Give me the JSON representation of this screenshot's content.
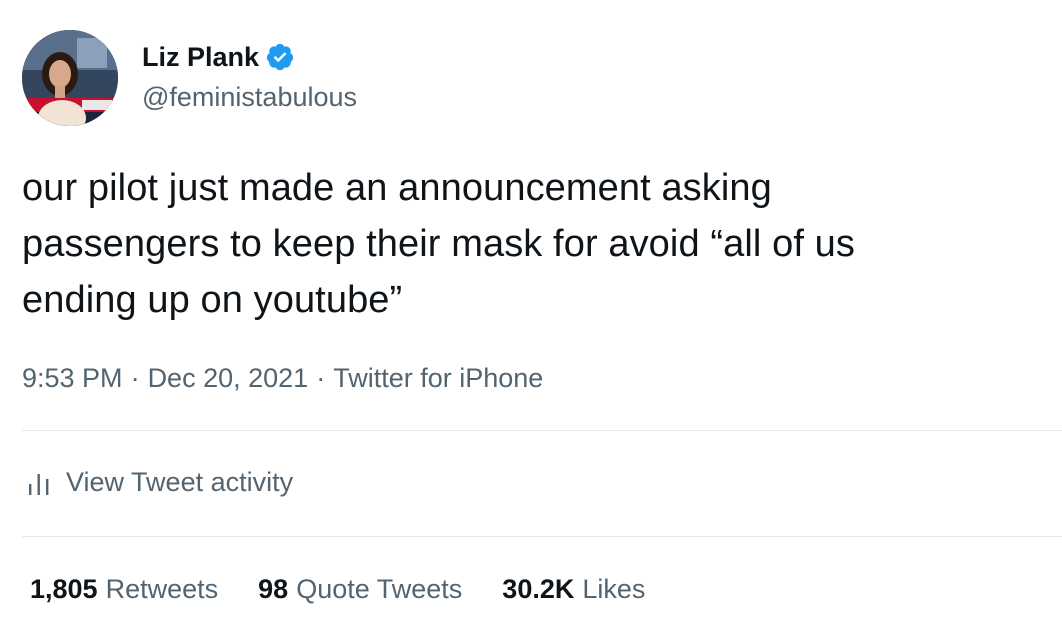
{
  "author": {
    "display_name": "Liz Plank",
    "handle": "@feministabulous",
    "verified": true,
    "avatar_icon": "profile-photo-news-set"
  },
  "tweet": {
    "text": "our pilot just made an announcement asking\npassengers to keep their mask for avoid “all of us\nending up on youtube”",
    "time": "9:53 PM",
    "date": "Dec 20, 2021",
    "source": "Twitter for iPhone",
    "separator": "·"
  },
  "activity": {
    "label": "View Tweet activity",
    "icon": "bar-chart-icon"
  },
  "stats": [
    {
      "count": "1,805",
      "label": "Retweets"
    },
    {
      "count": "98",
      "label": "Quote Tweets"
    },
    {
      "count": "30.2K",
      "label": "Likes"
    }
  ],
  "colors": {
    "primary_text": "#0f1419",
    "secondary_text": "#536471",
    "verified_blue": "#1d9bf0",
    "divider": "#e7e9ea"
  }
}
